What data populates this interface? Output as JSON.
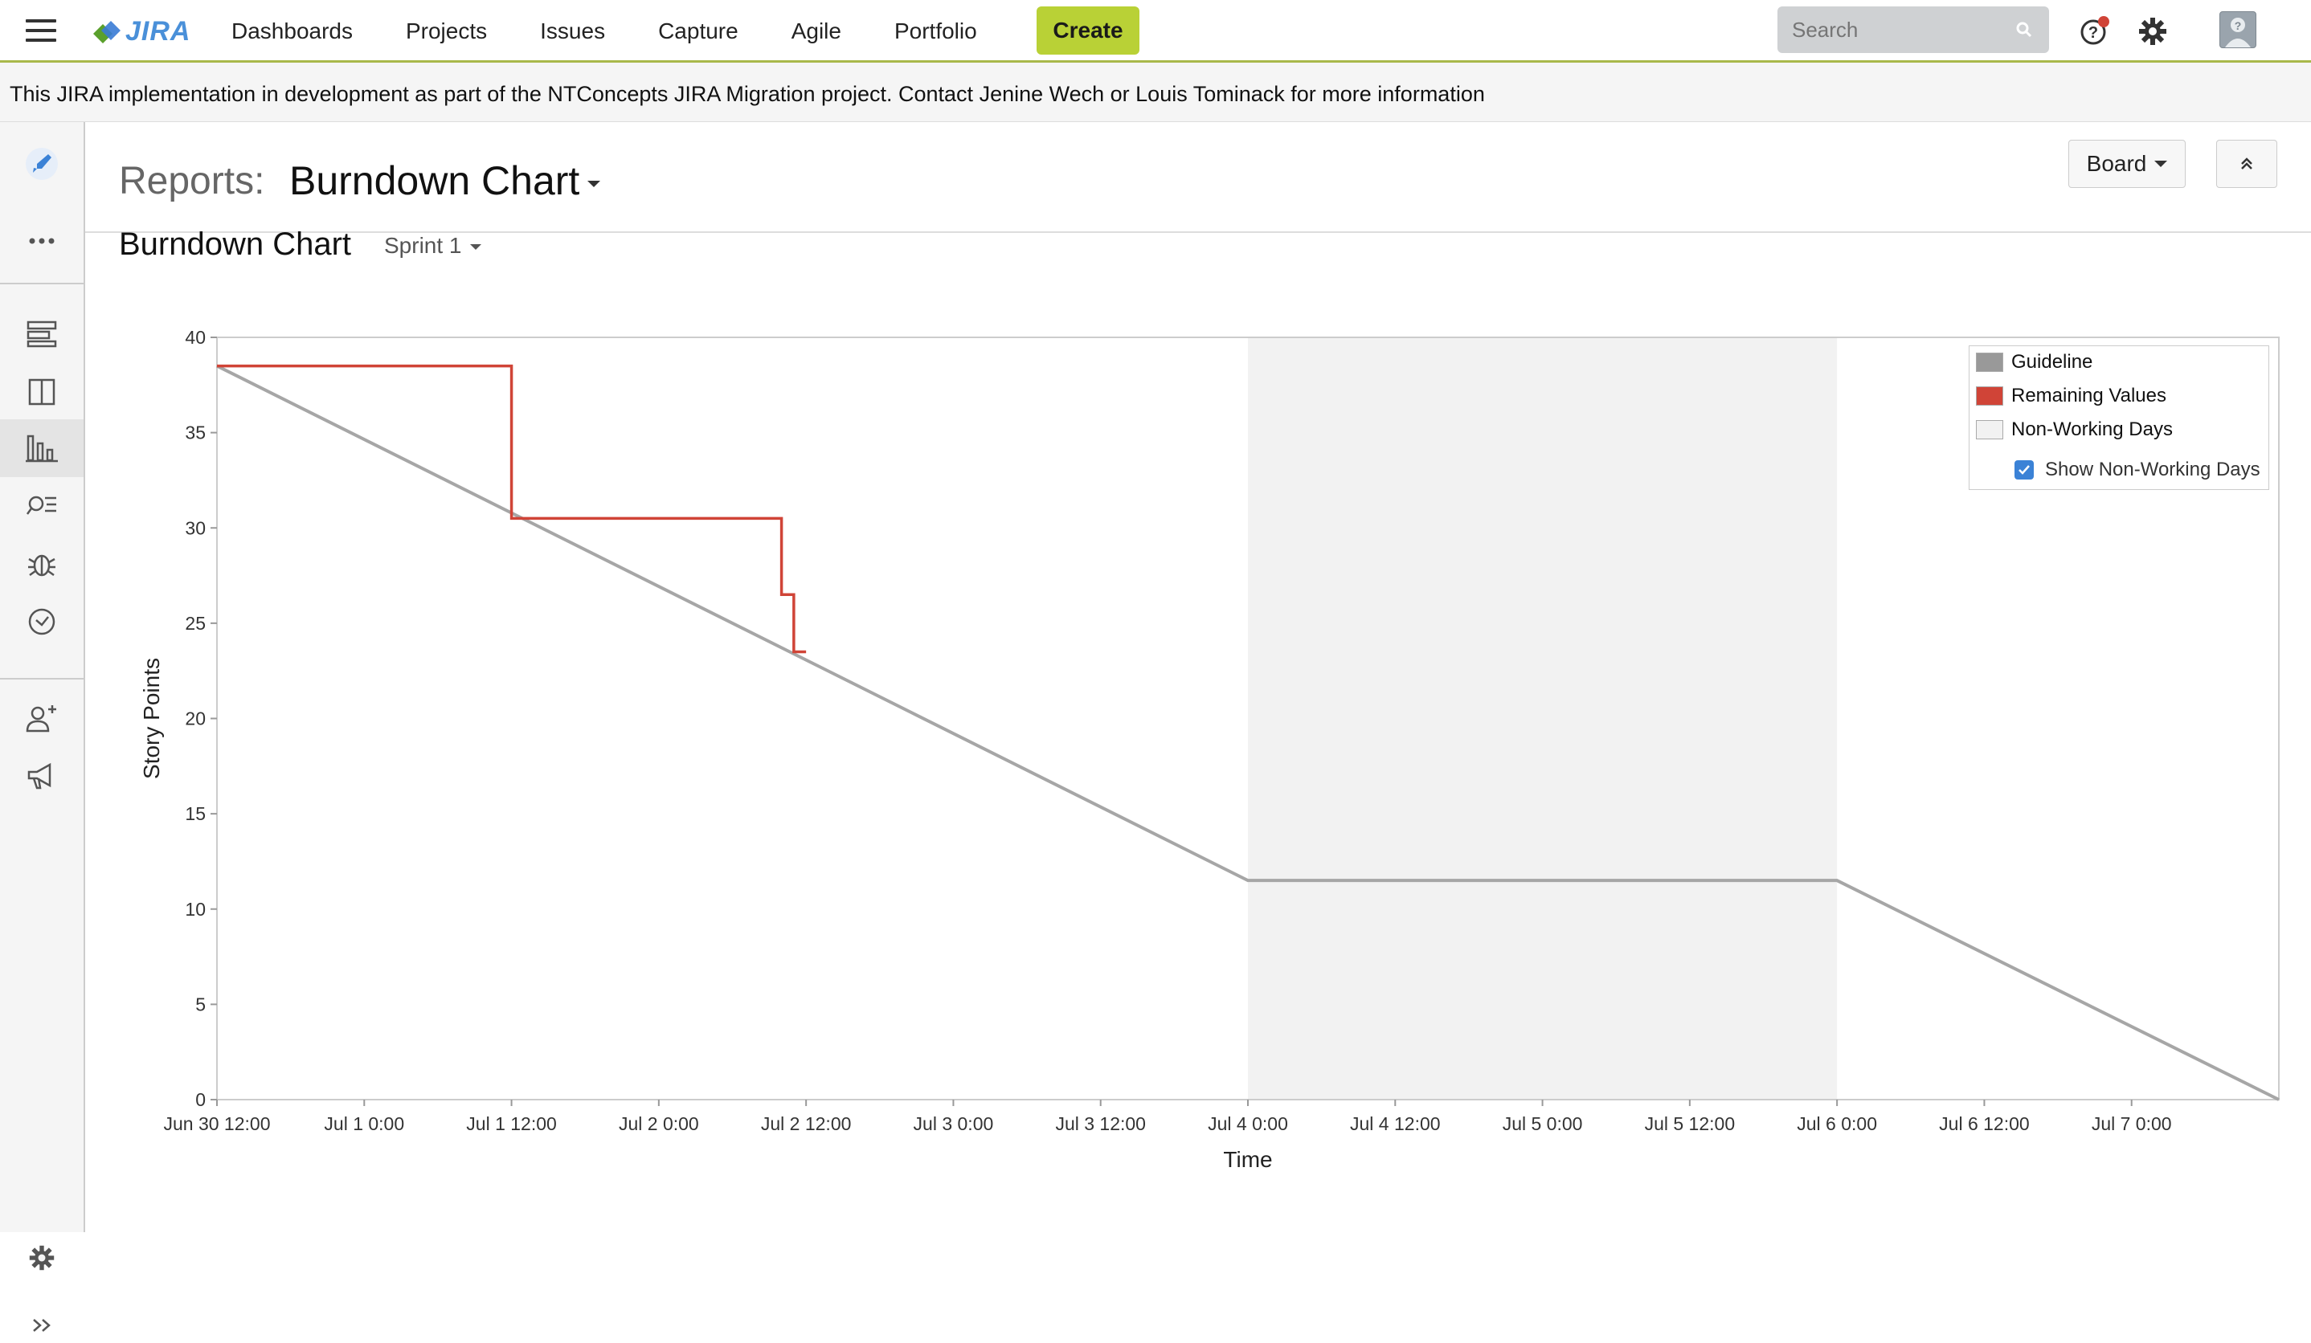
{
  "topnav": {
    "logo_text": "JIRA",
    "links": [
      "Dashboards",
      "Projects",
      "Issues",
      "Capture",
      "Agile",
      "Portfolio"
    ],
    "create_label": "Create",
    "search_placeholder": "Search"
  },
  "banner": {
    "text": "This JIRA implementation in development as part of the NTConcepts JIRA Migration project. Contact Jenine Wech or Louis Tominack for more information"
  },
  "header": {
    "reports_label": "Reports:",
    "title": "Burndown Chart",
    "board_label": "Board"
  },
  "report": {
    "subtitle": "Burndown Chart",
    "sprint": "Sprint 1"
  },
  "sidebar": {
    "icons": [
      "rocket-icon",
      "more-icon",
      "backlog-icon",
      "board-icon",
      "reports-icon",
      "issues-search-icon",
      "bug-icon",
      "clock-icon",
      "add-person-icon",
      "megaphone-icon",
      "settings-icon",
      "expand-icon"
    ],
    "active": "reports-icon"
  },
  "colors": {
    "guideline": "#a6a6a6",
    "remaining": "#d04437",
    "non_working": "#f2f2f2",
    "create_button": "#b9d136"
  },
  "chart_data": {
    "type": "line",
    "xlabel": "Time",
    "ylabel": "Story Points",
    "ylim": [
      0,
      40
    ],
    "y_ticks": [
      "0",
      "5",
      "10",
      "15",
      "20",
      "25",
      "30",
      "35",
      "40"
    ],
    "x_ticks": [
      "Jun 30 12:00",
      "Jul 1 0:00",
      "Jul 1 12:00",
      "Jul 2 0:00",
      "Jul 2 12:00",
      "Jul 3 0:00",
      "Jul 3 12:00",
      "Jul 4 0:00",
      "Jul 4 12:00",
      "Jul 5 0:00",
      "Jul 5 12:00",
      "Jul 6 0:00",
      "Jul 6 12:00",
      "Jul 7 0:00"
    ],
    "legend": [
      "Guideline",
      "Remaining Values",
      "Non-Working Days"
    ],
    "legend_position": "top-right",
    "show_non_working_label": "Show Non-Working Days",
    "show_non_working_checked": true,
    "non_working_range": [
      "Jul 4 0:00",
      "Jul 6 0:00"
    ],
    "series": [
      {
        "name": "Guideline",
        "points": [
          [
            "Jun 30 12:00",
            38.5
          ],
          [
            "Jul 4 0:00",
            11.5
          ],
          [
            "Jul 6 0:00",
            11.5
          ],
          [
            "Jul 7 12:00",
            0
          ]
        ]
      },
      {
        "name": "Remaining Values",
        "points": [
          [
            "Jun 30 12:00",
            38.5
          ],
          [
            "Jul 1 12:00",
            38.5
          ],
          [
            "Jul 1 12:00",
            30.5
          ],
          [
            "Jul 2 10:00",
            30.5
          ],
          [
            "Jul 2 10:00",
            26.5
          ],
          [
            "Jul 2 11:00",
            26.5
          ],
          [
            "Jul 2 11:00",
            23.5
          ],
          [
            "Jul 2 12:00",
            23.5
          ]
        ]
      }
    ]
  }
}
